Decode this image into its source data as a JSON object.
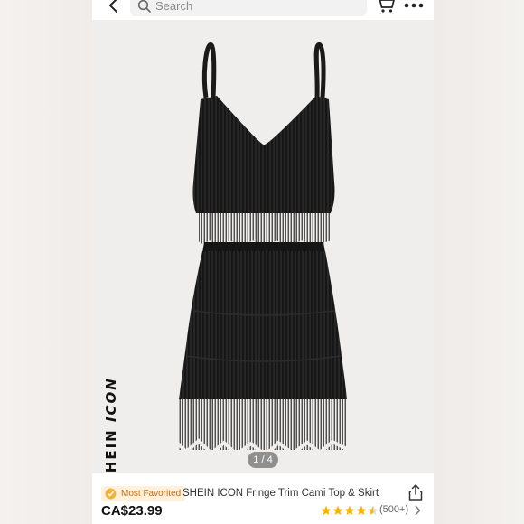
{
  "header": {
    "search_placeholder": "Search"
  },
  "gallery": {
    "brand_text": "SHEIN ICON",
    "page_indicator": "1 / 4"
  },
  "product": {
    "badge": "Most Favorited",
    "title": "SHEIN ICON Fringe Trim Cami Top & Skirt",
    "price": "CA$23.99",
    "rating": 4.5,
    "reviews": "(500+)"
  },
  "colors": {
    "price": "#111111",
    "star": "#f7b500",
    "badge_bg": "#fff1dc",
    "badge_text": "#c86a10",
    "garment": "#1a1a1a"
  }
}
